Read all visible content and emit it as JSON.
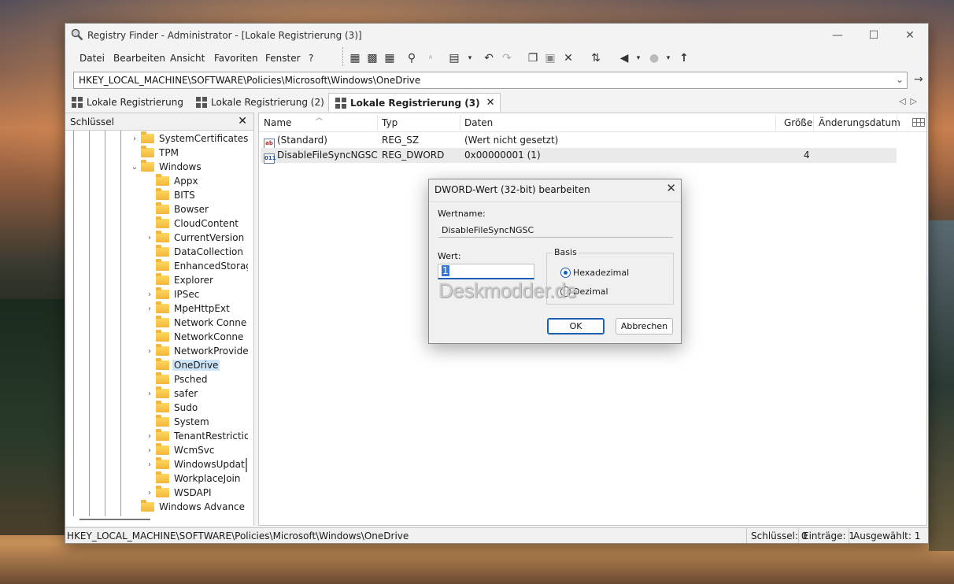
{
  "window": {
    "title": "Registry Finder - Administrator - [Lokale Registrierung (3)]",
    "controls": {
      "minimize": "—",
      "maximize": "☐",
      "close": "✕"
    }
  },
  "menu": [
    "Datei",
    "Bearbeiten",
    "Ansicht",
    "Favoriten",
    "Fenster",
    "?"
  ],
  "address": {
    "value": "HKEY_LOCAL_MACHINE\\SOFTWARE\\Policies\\Microsoft\\Windows\\OneDrive"
  },
  "tabs": [
    {
      "label": "Lokale Registrierung"
    },
    {
      "label": "Lokale Registrierung (2)"
    },
    {
      "label": "Lokale Registrierung (3)"
    }
  ],
  "tree": {
    "header": "Schlüssel",
    "items": [
      {
        "label": "SystemCertificates",
        "expander": "›"
      },
      {
        "label": "TPM",
        "expander": ""
      },
      {
        "label": "Windows",
        "expander": "⌄"
      },
      {
        "label": "Appx",
        "expander": ""
      },
      {
        "label": "BITS",
        "expander": ""
      },
      {
        "label": "Bowser",
        "expander": ""
      },
      {
        "label": "CloudContent",
        "expander": ""
      },
      {
        "label": "CurrentVersion",
        "expander": "›"
      },
      {
        "label": "DataCollection",
        "expander": ""
      },
      {
        "label": "EnhancedStorag",
        "expander": ""
      },
      {
        "label": "Explorer",
        "expander": ""
      },
      {
        "label": "IPSec",
        "expander": "›"
      },
      {
        "label": "MpeHttpExt",
        "expander": "›"
      },
      {
        "label": "Network Conne",
        "expander": ""
      },
      {
        "label": "NetworkConne",
        "expander": ""
      },
      {
        "label": "NetworkProvide",
        "expander": "›"
      },
      {
        "label": "OneDrive",
        "expander": ""
      },
      {
        "label": "Psched",
        "expander": ""
      },
      {
        "label": "safer",
        "expander": "›"
      },
      {
        "label": "Sudo",
        "expander": ""
      },
      {
        "label": "System",
        "expander": ""
      },
      {
        "label": "TenantRestrictio",
        "expander": "›"
      },
      {
        "label": "WcmSvc",
        "expander": "›"
      },
      {
        "label": "WindowsUpdat",
        "expander": "›"
      },
      {
        "label": "WorkplaceJoin",
        "expander": ""
      },
      {
        "label": "WSDAPI",
        "expander": "›"
      },
      {
        "label": "Windows Advance",
        "expander": ""
      }
    ]
  },
  "list": {
    "columns": [
      "Name",
      "Typ",
      "Daten",
      "Größe",
      "Änderungsdatum"
    ],
    "rows": [
      {
        "icon": "ab",
        "name": "(Standard)",
        "type": "REG_SZ",
        "data": "(Wert nicht gesetzt)",
        "size": "",
        "date": ""
      },
      {
        "icon": "011",
        "name": "DisableFileSyncNGSC",
        "type": "REG_DWORD",
        "data": "0x00000001 (1)",
        "size": "4",
        "date": ""
      }
    ]
  },
  "status": {
    "path": "HKEY_LOCAL_MACHINE\\SOFTWARE\\Policies\\Microsoft\\Windows\\OneDrive",
    "keys": "Schlüssel: 0",
    "entries": "Einträge: 1",
    "selected": "Ausgewählt: 1"
  },
  "dialog": {
    "title": "DWORD-Wert (32-bit) bearbeiten",
    "name_label": "Wertname:",
    "name_value": "DisableFileSyncNGSC",
    "value_label": "Wert:",
    "value": "1",
    "base_label": "Basis",
    "radio_hex": "Hexadezimal",
    "radio_dec": "Dezimal",
    "selected_base": "Hexadezimal",
    "ok": "OK",
    "cancel": "Abbrechen",
    "watermark": "Deskmodder.de"
  }
}
